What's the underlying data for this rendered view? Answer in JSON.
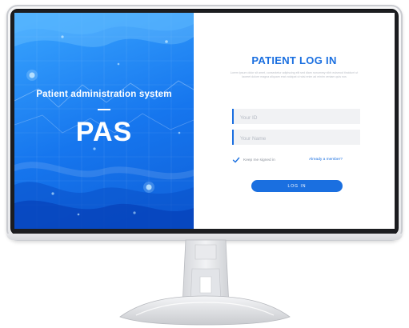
{
  "brand": {
    "subtitle": "Patient administration system",
    "dash": "—",
    "title": "PAS"
  },
  "login": {
    "title": "PATIENT LOG IN",
    "description": "Lorem ipsum dolor sit amet, consectetur adipiscing elit sed diam nonummy nibh euismod tincidunt ut laoreet dolore magna aliquam erat volutpat ut wisi enim ad minim veniam quis nos",
    "id_placeholder": "Your ID",
    "name_placeholder": "Your Name",
    "keep_signed_in": "Keep me signed in",
    "member_link": "Already a member?",
    "button": "LOG IN"
  },
  "colors": {
    "accent": "#1a6fe0",
    "panel_light": "#3aa6ff",
    "panel_dark": "#0f5fd8"
  },
  "icons": {
    "check": "check-icon"
  }
}
